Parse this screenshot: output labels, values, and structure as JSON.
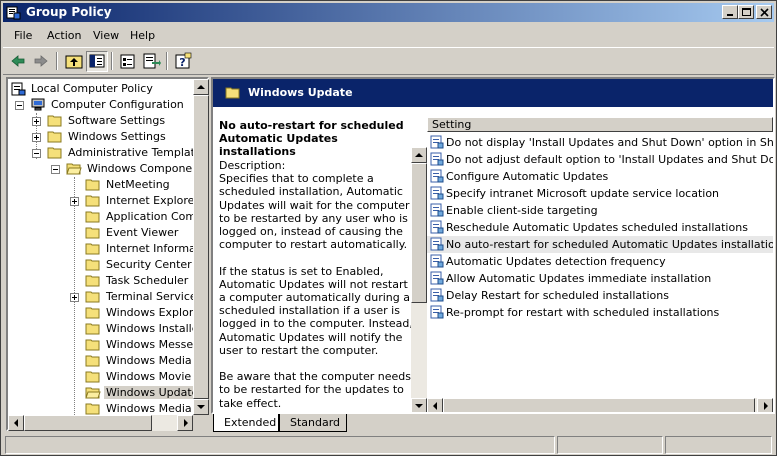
{
  "window": {
    "title": "Group Policy"
  },
  "menu": [
    "File",
    "Action",
    "View",
    "Help"
  ],
  "tree": {
    "items": [
      {
        "label": "Local Computer Policy",
        "icon": "policy-icon"
      },
      {
        "label": "Computer Configuration",
        "icon": "computer-icon"
      },
      {
        "label": "Software Settings",
        "icon": "folder-icon"
      },
      {
        "label": "Windows Settings",
        "icon": "folder-icon"
      },
      {
        "label": "Administrative Templates",
        "icon": "folder-icon"
      },
      {
        "label": "Windows Components",
        "icon": "folder-open-icon"
      },
      {
        "label": "NetMeeting",
        "icon": "folder-icon"
      },
      {
        "label": "Internet Explorer",
        "icon": "folder-icon"
      },
      {
        "label": "Application Compa",
        "icon": "folder-icon"
      },
      {
        "label": "Event Viewer",
        "icon": "folder-icon"
      },
      {
        "label": "Internet Informati",
        "icon": "folder-icon"
      },
      {
        "label": "Security Center",
        "icon": "folder-icon"
      },
      {
        "label": "Task Scheduler",
        "icon": "folder-icon"
      },
      {
        "label": "Terminal Services",
        "icon": "folder-icon"
      },
      {
        "label": "Windows Explorer",
        "icon": "folder-icon"
      },
      {
        "label": "Windows Installer",
        "icon": "folder-icon"
      },
      {
        "label": "Windows Messeng",
        "icon": "folder-icon"
      },
      {
        "label": "Windows Media Di",
        "icon": "folder-icon"
      },
      {
        "label": "Windows Movie Ma",
        "icon": "folder-icon"
      },
      {
        "label": "Windows Update",
        "icon": "folder-open-icon",
        "selected": true
      },
      {
        "label": "Windows Media Pla",
        "icon": "folder-icon"
      }
    ]
  },
  "detail": {
    "header": "Windows Update",
    "desc_title": "No auto-restart for scheduled Automatic Updates installations",
    "desc_body": "Description:\nSpecifies that to complete a scheduled installation, Automatic Updates will wait for the computer to be restarted by any user who is logged on, instead of causing the computer to restart automatically.\n\nIf the status is set to Enabled, Automatic Updates will not restart a computer automatically during a scheduled installation if a user is logged in to the computer. Instead, Automatic Updates will notify the user to restart the computer.\n\nBe aware that the computer needs to be restarted for the updates to take effect."
  },
  "list": {
    "column": "Setting",
    "rows": [
      "Do not display 'Install Updates and Shut Down' option in Shut Dow...",
      "Do not adjust default option to 'Install Updates and Shut Down' in...",
      "Configure Automatic Updates",
      "Specify intranet Microsoft update service location",
      "Enable client-side targeting",
      "Reschedule Automatic Updates scheduled installations",
      "No auto-restart for scheduled Automatic Updates installations",
      "Automatic Updates detection frequency",
      "Allow Automatic Updates immediate installation",
      "Delay Restart for scheduled installations",
      "Re-prompt for restart with scheduled installations"
    ],
    "selected_index": 6
  },
  "tabs": [
    "Extended",
    "Standard"
  ],
  "colors": {
    "title_bar": "#0a246a",
    "face": "#d4d0c8"
  }
}
